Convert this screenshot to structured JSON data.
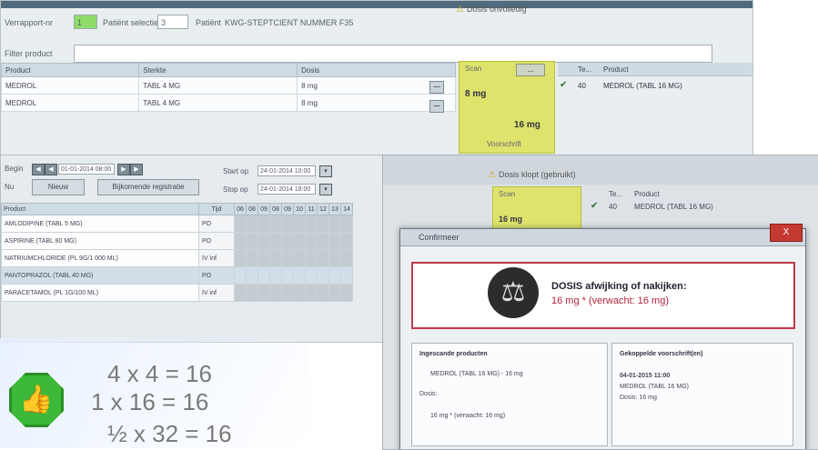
{
  "screen1": {
    "filter_labels": {
      "verrapport": "Verrapport-nr",
      "patient_count_label": "Patiënt selectie",
      "patient_label": "Patiënt"
    },
    "verrapport_value": "1",
    "patient_count_value": "3",
    "patient_value": "KWG-STEPTCIENT NUMMER F35",
    "warning": "Dosis onvolledig",
    "filter_label": "Filter product",
    "table": {
      "headers": [
        "Product",
        "Sterkte",
        "Dosis"
      ],
      "rows": [
        [
          "MEDROL",
          "TABL 4 MG",
          "8 mg"
        ],
        [
          "MEDROL",
          "TABL 4 MG",
          "8 mg"
        ]
      ]
    },
    "scan": {
      "header": "Scan",
      "button": "...",
      "value1": "8 mg",
      "value2": "16 mg",
      "footer": "Voorschrift"
    },
    "product_panel": {
      "headers": [
        "Te...",
        "Product"
      ],
      "row": {
        "qty": "40",
        "product": "MEDROL (TABL 16 MG)"
      }
    }
  },
  "screen2": {
    "nav": {
      "begin_label": "Begin",
      "date_value": "01-01-2014 08:00",
      "now_button": "Nu",
      "start_label": "Start op",
      "start_value": "24-01-2014 10:00",
      "end_label": "Stop op",
      "end_value": "24-01-2014 18:00",
      "buttons": [
        "Nieuw",
        "Bijkomende registratie"
      ]
    },
    "table": {
      "headers": [
        "Product",
        "Tijd",
        "06",
        "08",
        "09",
        "08",
        "09",
        "10",
        "11",
        "12",
        "13",
        "14"
      ],
      "rows": [
        {
          "product": "AMLODIPINE (TABL 5 MG)",
          "time": "PO"
        },
        {
          "product": "ASPIRINE (TABL 80 MG)",
          "time": "PO"
        },
        {
          "product": "NATRIUMCHLORIDE (PL 9G/1 000 ML)",
          "time": "IV inf"
        },
        {
          "product": "PANTOPRAZOL (TABL 40 MG)",
          "time": "PO"
        },
        {
          "product": "PARACETAMOL (PL 1G/100 ML)",
          "time": "IV inf"
        }
      ]
    }
  },
  "screen3": {
    "warning": "Dosis klopt (gebruikt)",
    "scan_header": "Scan",
    "scan_value": "16 mg",
    "product_headers": [
      "Te...",
      "Product"
    ],
    "product_row": {
      "qty": "40",
      "product": "MEDROL (TABL 16 MG)"
    },
    "dialog": {
      "title": "Confirmeer",
      "close": "X",
      "alert_title": "DOSIS afwijking of nakijken:",
      "alert_detail": "16 mg * (verwacht: 16 mg)",
      "left_panel": {
        "header": "Ingescande producten",
        "item": "MEDROL (TABL 16 MG) - 16 mg",
        "dose_label": "Dosis:",
        "dose_item": "16 mg * (verwacht: 16 mg)"
      },
      "right_panel": {
        "header": "Gekoppelde voorschrift(en)",
        "date": "04-01-2015 11:00",
        "product": "MEDROL (TABL 16 MG)",
        "dose": "Dosis: 16 mg"
      }
    }
  },
  "equations": [
    "4 x 4 = 16",
    "1 x 16 = 16",
    "½ x 32 = 16"
  ],
  "colors": {
    "scan_box": "#dde36b",
    "ok_green": "#3db838",
    "alert_red": "#c0394b"
  },
  "icons": [
    "warning-icon",
    "checkmark-icon",
    "thumbs-up-icon",
    "scales-icon",
    "close-icon"
  ]
}
